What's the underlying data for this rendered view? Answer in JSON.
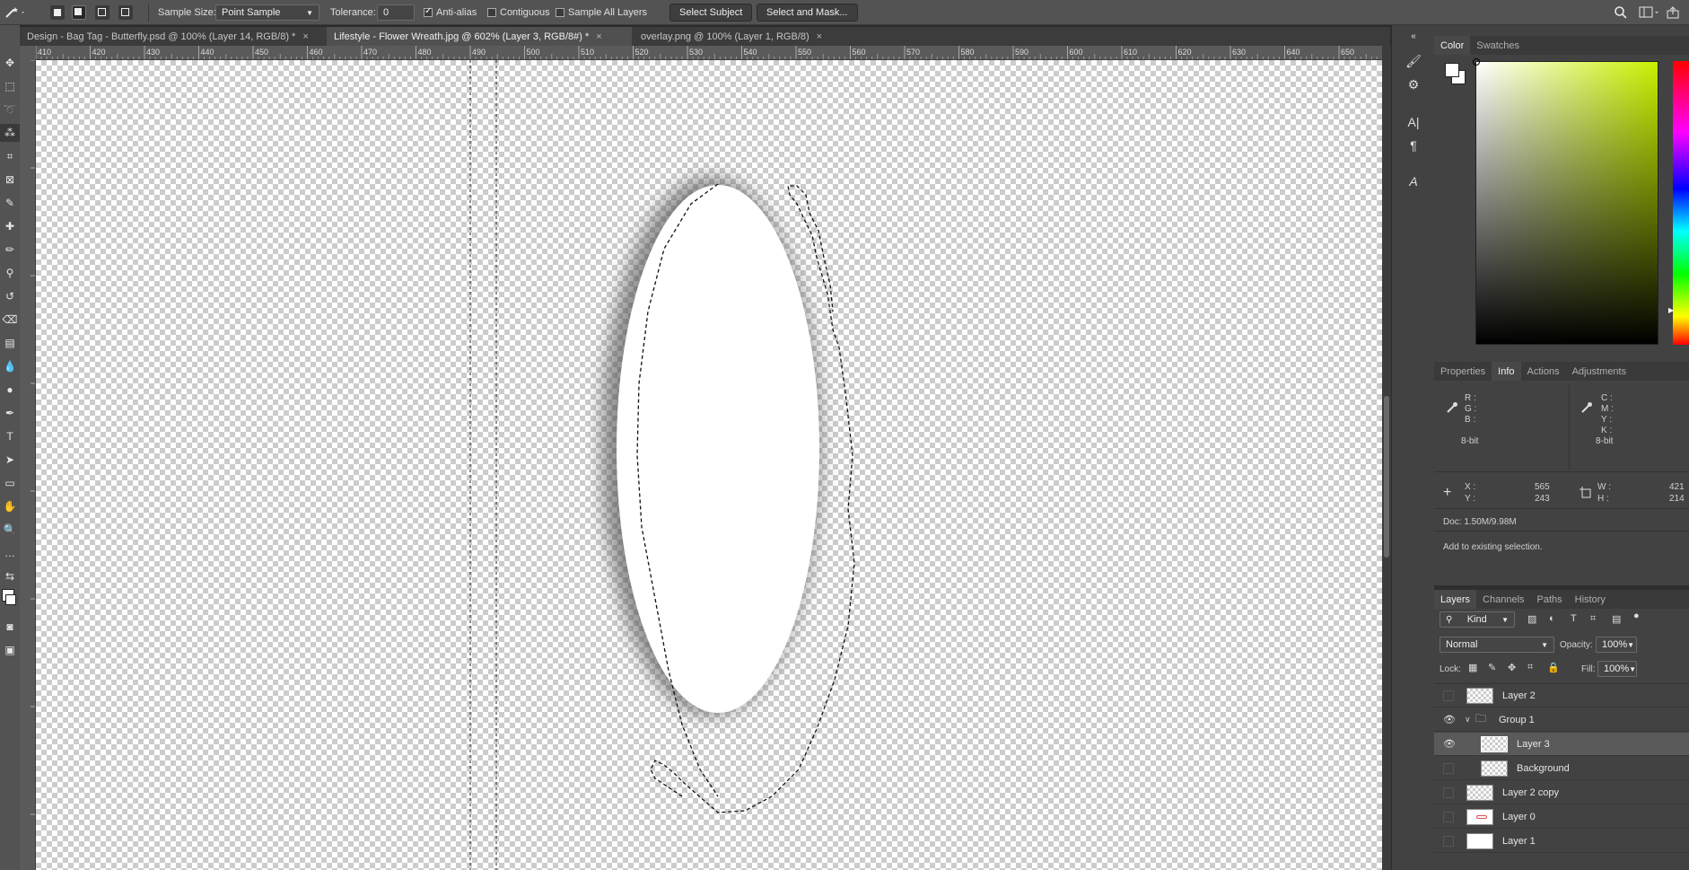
{
  "options": {
    "sample_size_label": "Sample Size:",
    "sample_size_value": "Point Sample",
    "tolerance_label": "Tolerance:",
    "tolerance_value": "0",
    "antialias_label": "Anti-alias",
    "contiguous_label": "Contiguous",
    "sample_all_label": "Sample All Layers",
    "select_subject": "Select Subject",
    "select_mask": "Select and Mask..."
  },
  "tabs": [
    {
      "label": "Design - Bag Tag - Butterfly.psd @ 100% (Layer 14, RGB/8) *",
      "close": "×"
    },
    {
      "label": "Lifestyle - Flower Wreath.jpg @ 602% (Layer 3, RGB/8#) *",
      "close": "×"
    },
    {
      "label": "overlay.png @ 100% (Layer 1, RGB/8)",
      "close": "×"
    }
  ],
  "ruler_h": [
    "410",
    "420",
    "430",
    "440",
    "450",
    "460",
    "470",
    "480",
    "490",
    "500",
    "510",
    "520",
    "530",
    "540",
    "550",
    "560",
    "570",
    "580",
    "590",
    "600",
    "610",
    "620",
    "630",
    "640",
    "650"
  ],
  "color_panel": {
    "tabs": [
      "Color",
      "Swatches"
    ]
  },
  "info_panel": {
    "tabs": [
      "Properties",
      "Info",
      "Actions",
      "Adjustments"
    ],
    "rgb": [
      "R :",
      "G :",
      "B :"
    ],
    "cmyk": [
      "C :",
      "M :",
      "Y :",
      "K :"
    ],
    "bit_left": "8-bit",
    "bit_right": "8-bit",
    "x_label": "X :",
    "x_value": "565",
    "y_label": "Y :",
    "y_value": "243",
    "w_label": "W :",
    "w_value": "421",
    "h_label": "H :",
    "h_value": "214",
    "doc": "Doc: 1.50M/9.98M",
    "status": "Add to existing selection."
  },
  "layers_panel": {
    "tabs": [
      "Layers",
      "Channels",
      "Paths",
      "History"
    ],
    "kind": "Kind",
    "blend_mode": "Normal",
    "opacity_label": "Opacity:",
    "opacity_value": "100%",
    "lock_label": "Lock:",
    "fill_label": "Fill:",
    "fill_value": "100%",
    "layers": [
      {
        "name": "Layer 2",
        "visible": false
      },
      {
        "name": "Group 1",
        "visible": true
      },
      {
        "name": "Layer 3",
        "visible": true
      },
      {
        "name": "Background",
        "visible": false
      },
      {
        "name": "Layer 2 copy",
        "visible": false
      },
      {
        "name": "Layer 0",
        "visible": false
      },
      {
        "name": "Layer 1",
        "visible": false
      }
    ]
  },
  "accent_colors": {
    "hue_top": "#c8f000",
    "panel_bg": "#424242",
    "canvas_check": "#cccccc"
  }
}
